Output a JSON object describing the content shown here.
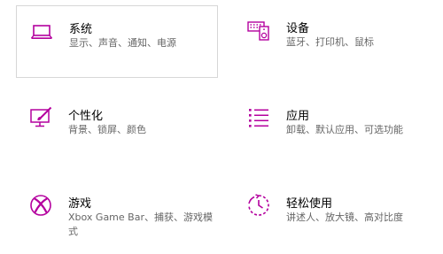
{
  "accent_color": "#b4009e",
  "tiles": [
    {
      "title": "系统",
      "desc": "显示、声音、通知、电源",
      "icon": "laptop-icon"
    },
    {
      "title": "设备",
      "desc": "蓝牙、打印机、鼠标",
      "icon": "devices-icon"
    },
    {
      "title": "个性化",
      "desc": "背景、锁屏、颜色",
      "icon": "personalization-icon"
    },
    {
      "title": "应用",
      "desc": "卸载、默认应用、可选功能",
      "icon": "apps-list-icon"
    },
    {
      "title": "游戏",
      "desc": "Xbox Game Bar、捕获、游戏模式",
      "icon": "xbox-icon"
    },
    {
      "title": "轻松使用",
      "desc": "讲述人、放大镜、高对比度",
      "icon": "ease-of-access-icon"
    }
  ]
}
